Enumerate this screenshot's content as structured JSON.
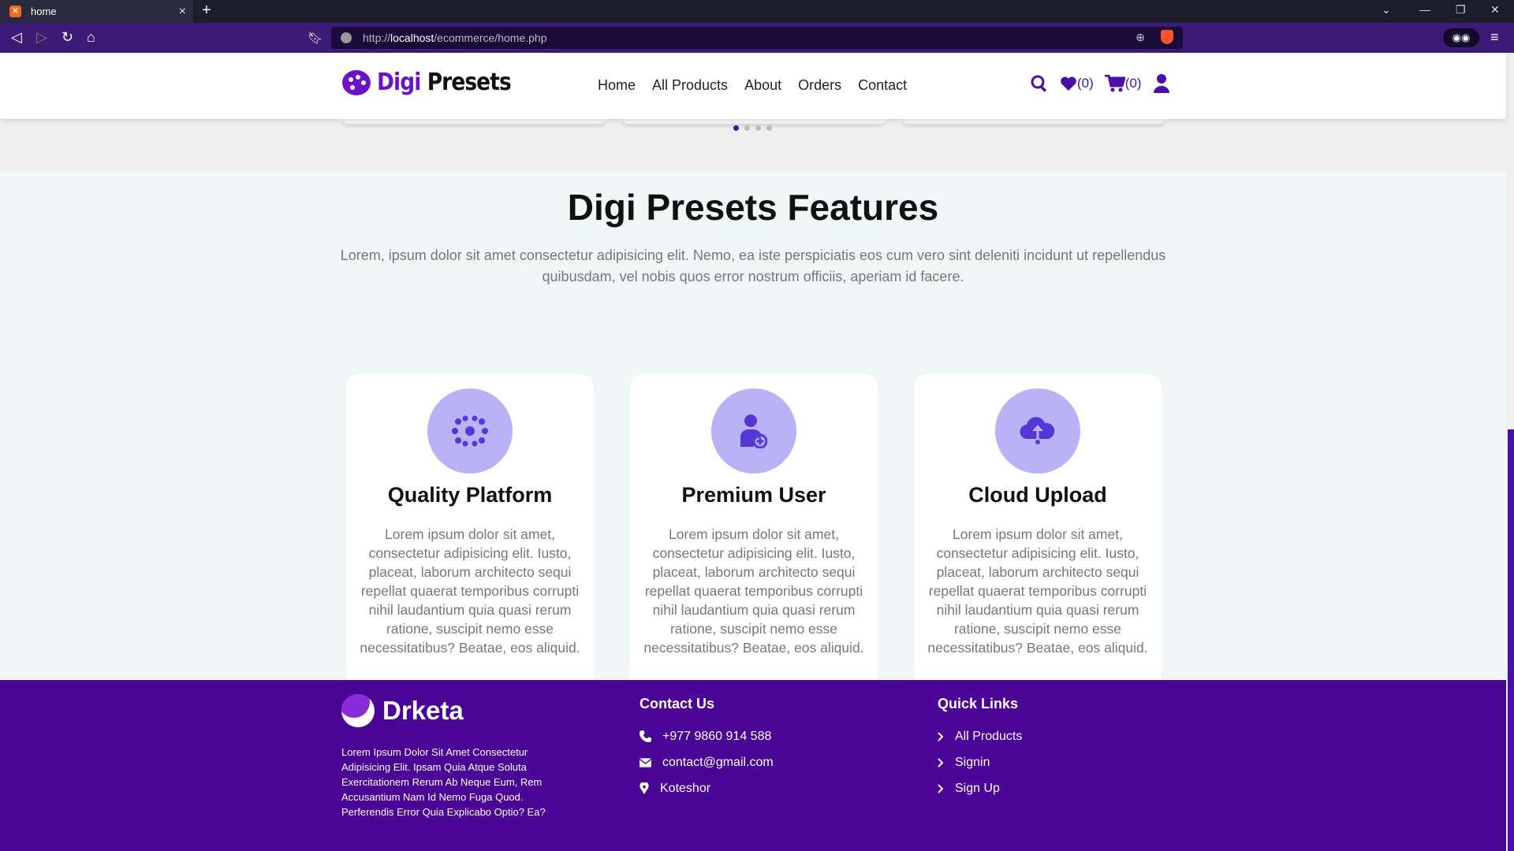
{
  "browser": {
    "tab_title": "home",
    "url_prefix": "http://",
    "url_host": "localhost",
    "url_path": "/ecommerce/home.php"
  },
  "header": {
    "logo_word1": "Digi",
    "logo_word2": "Presets",
    "nav": [
      "Home",
      "All Products",
      "About",
      "Orders",
      "Contact"
    ],
    "wishlist_count": "(0)",
    "cart_count": "(0)"
  },
  "features": {
    "title": "Digi Presets Features",
    "subtitle": "Lorem, ipsum dolor sit amet consectetur adipisicing elit. Nemo, ea iste perspiciatis eos cum vero sint deleniti incidunt ut repellendus quibusdam, vel nobis quos error nostrum officiis, aperiam id facere.",
    "cards": [
      {
        "title": "Quality Platform",
        "icon": "network-icon",
        "text": "Lorem ipsum dolor sit amet, consectetur adipisicing elit. Iusto, placeat, laborum architecto sequi repellat quaerat temporibus corrupti nihil laudantium quia quasi rerum ratione, suscipit nemo esse necessitatibus? Beatae, eos aliquid."
      },
      {
        "title": "Premium User",
        "icon": "user-plus-icon",
        "text": "Lorem ipsum dolor sit amet, consectetur adipisicing elit. Iusto, placeat, laborum architecto sequi repellat quaerat temporibus corrupti nihil laudantium quia quasi rerum ratione, suscipit nemo esse necessitatibus? Beatae, eos aliquid."
      },
      {
        "title": "Cloud Upload",
        "icon": "cloud-upload-icon",
        "text": "Lorem ipsum dolor sit amet, consectetur adipisicing elit. Iusto, placeat, laborum architecto sequi repellat quaerat temporibus corrupti nihil laudantium quia quasi rerum ratione, suscipit nemo esse necessitatibus? Beatae, eos aliquid."
      }
    ]
  },
  "footer": {
    "brand": "Drketa",
    "description": "Lorem Ipsum Dolor Sit Amet Consectetur Adipisicing Elit. Ipsam Quia Atque Soluta Exercitationem Rerum Ab Neque Eum, Rem Accusantium Nam Id Nemo Fuga Quod. Perferendis Error Quia Explicabo Optio? Ea?",
    "contact_heading": "Contact Us",
    "phone": "+977 9860 914 588",
    "email": "contact@gmail.com",
    "location": "Koteshor",
    "links_heading": "Quick Links",
    "links": [
      "All Products",
      "Signin",
      "Sign Up"
    ]
  },
  "colors": {
    "brand": "#4a0fa8",
    "footer_bg": "#4a0496",
    "feature_circle": "#b9b2f6",
    "features_bg": "#eff8f7"
  }
}
